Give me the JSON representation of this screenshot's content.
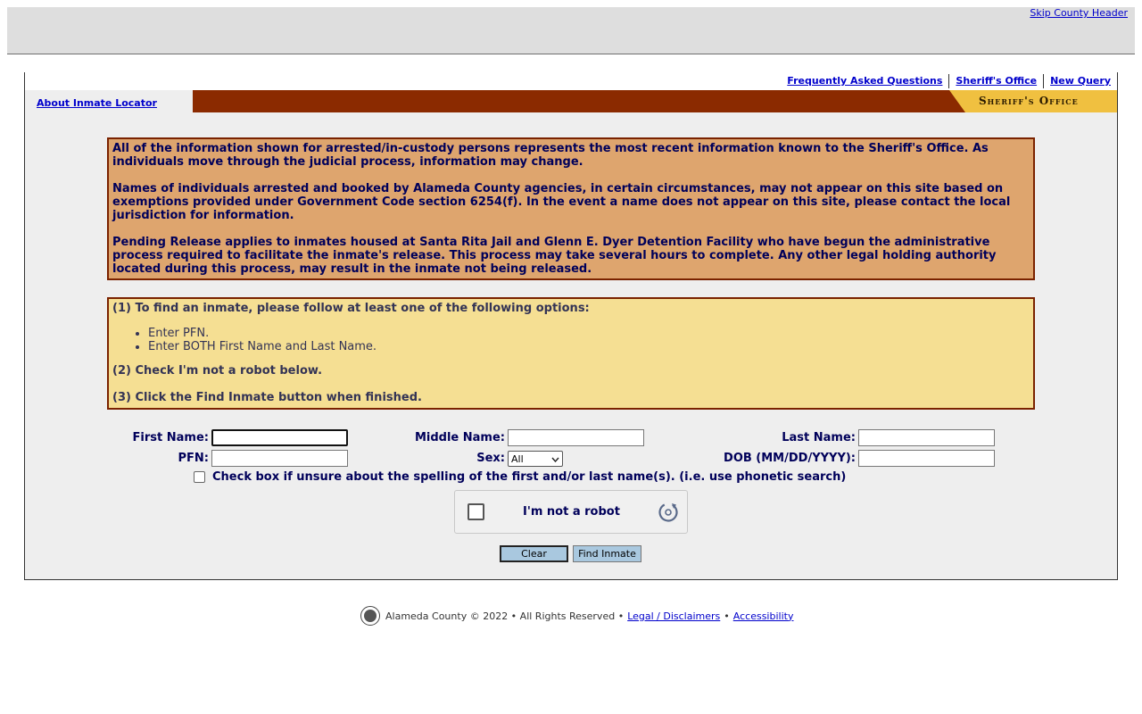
{
  "header": {
    "skip_link": "Skip County Header"
  },
  "top_links": [
    "Frequently Asked Questions",
    "Sheriff's Office",
    "New Query"
  ],
  "tab": {
    "about_label": "About Inmate Locator",
    "logo_text": "Sheriff's Office"
  },
  "notice": [
    "All of the information shown for arrested/in-custody persons represents the most recent information known to the Sheriff's Office.  As individuals move through the judicial process, information may change.",
    "Names of individuals arrested and booked by Alameda County agencies, in certain circumstances, may not appear on this site based on exemptions provided under Government Code section 6254(f).  In the event a name does not appear on this site, please contact the local jurisdiction for information.",
    "Pending Release applies to inmates housed at Santa Rita Jail and Glenn E. Dyer Detention Facility who have begun the administrative process required to facilitate the inmate's release.  This process may take several hours to complete.  Any other legal holding authority located during this process, may result in the inmate not being released."
  ],
  "instructions": {
    "step1": "(1) To find an inmate, please follow at least one of the following options:",
    "options": [
      "Enter PFN.",
      "Enter BOTH First Name and Last Name."
    ],
    "step2": "(2) Check I'm not a robot below.",
    "step3": "(3) Click the Find Inmate button when finished."
  },
  "form": {
    "first_name_label": "First Name:",
    "middle_name_label": "Middle Name:",
    "last_name_label": "Last Name:",
    "pfn_label": "PFN:",
    "sex_label": "Sex:",
    "sex_value": "All",
    "dob_label": "DOB (MM/DD/YYYY):",
    "phonetic_label": "Check box if unsure about the spelling of the first and/or last name(s). (i.e. use phonetic search)",
    "captcha_label": "I'm not a robot",
    "clear_label": "Clear",
    "find_label": "Find Inmate"
  },
  "footer": {
    "copyright": "Alameda County © 2022 • All Rights Reserved •",
    "legal": "Legal / Disclaimers",
    "accessibility": "Accessibility"
  }
}
